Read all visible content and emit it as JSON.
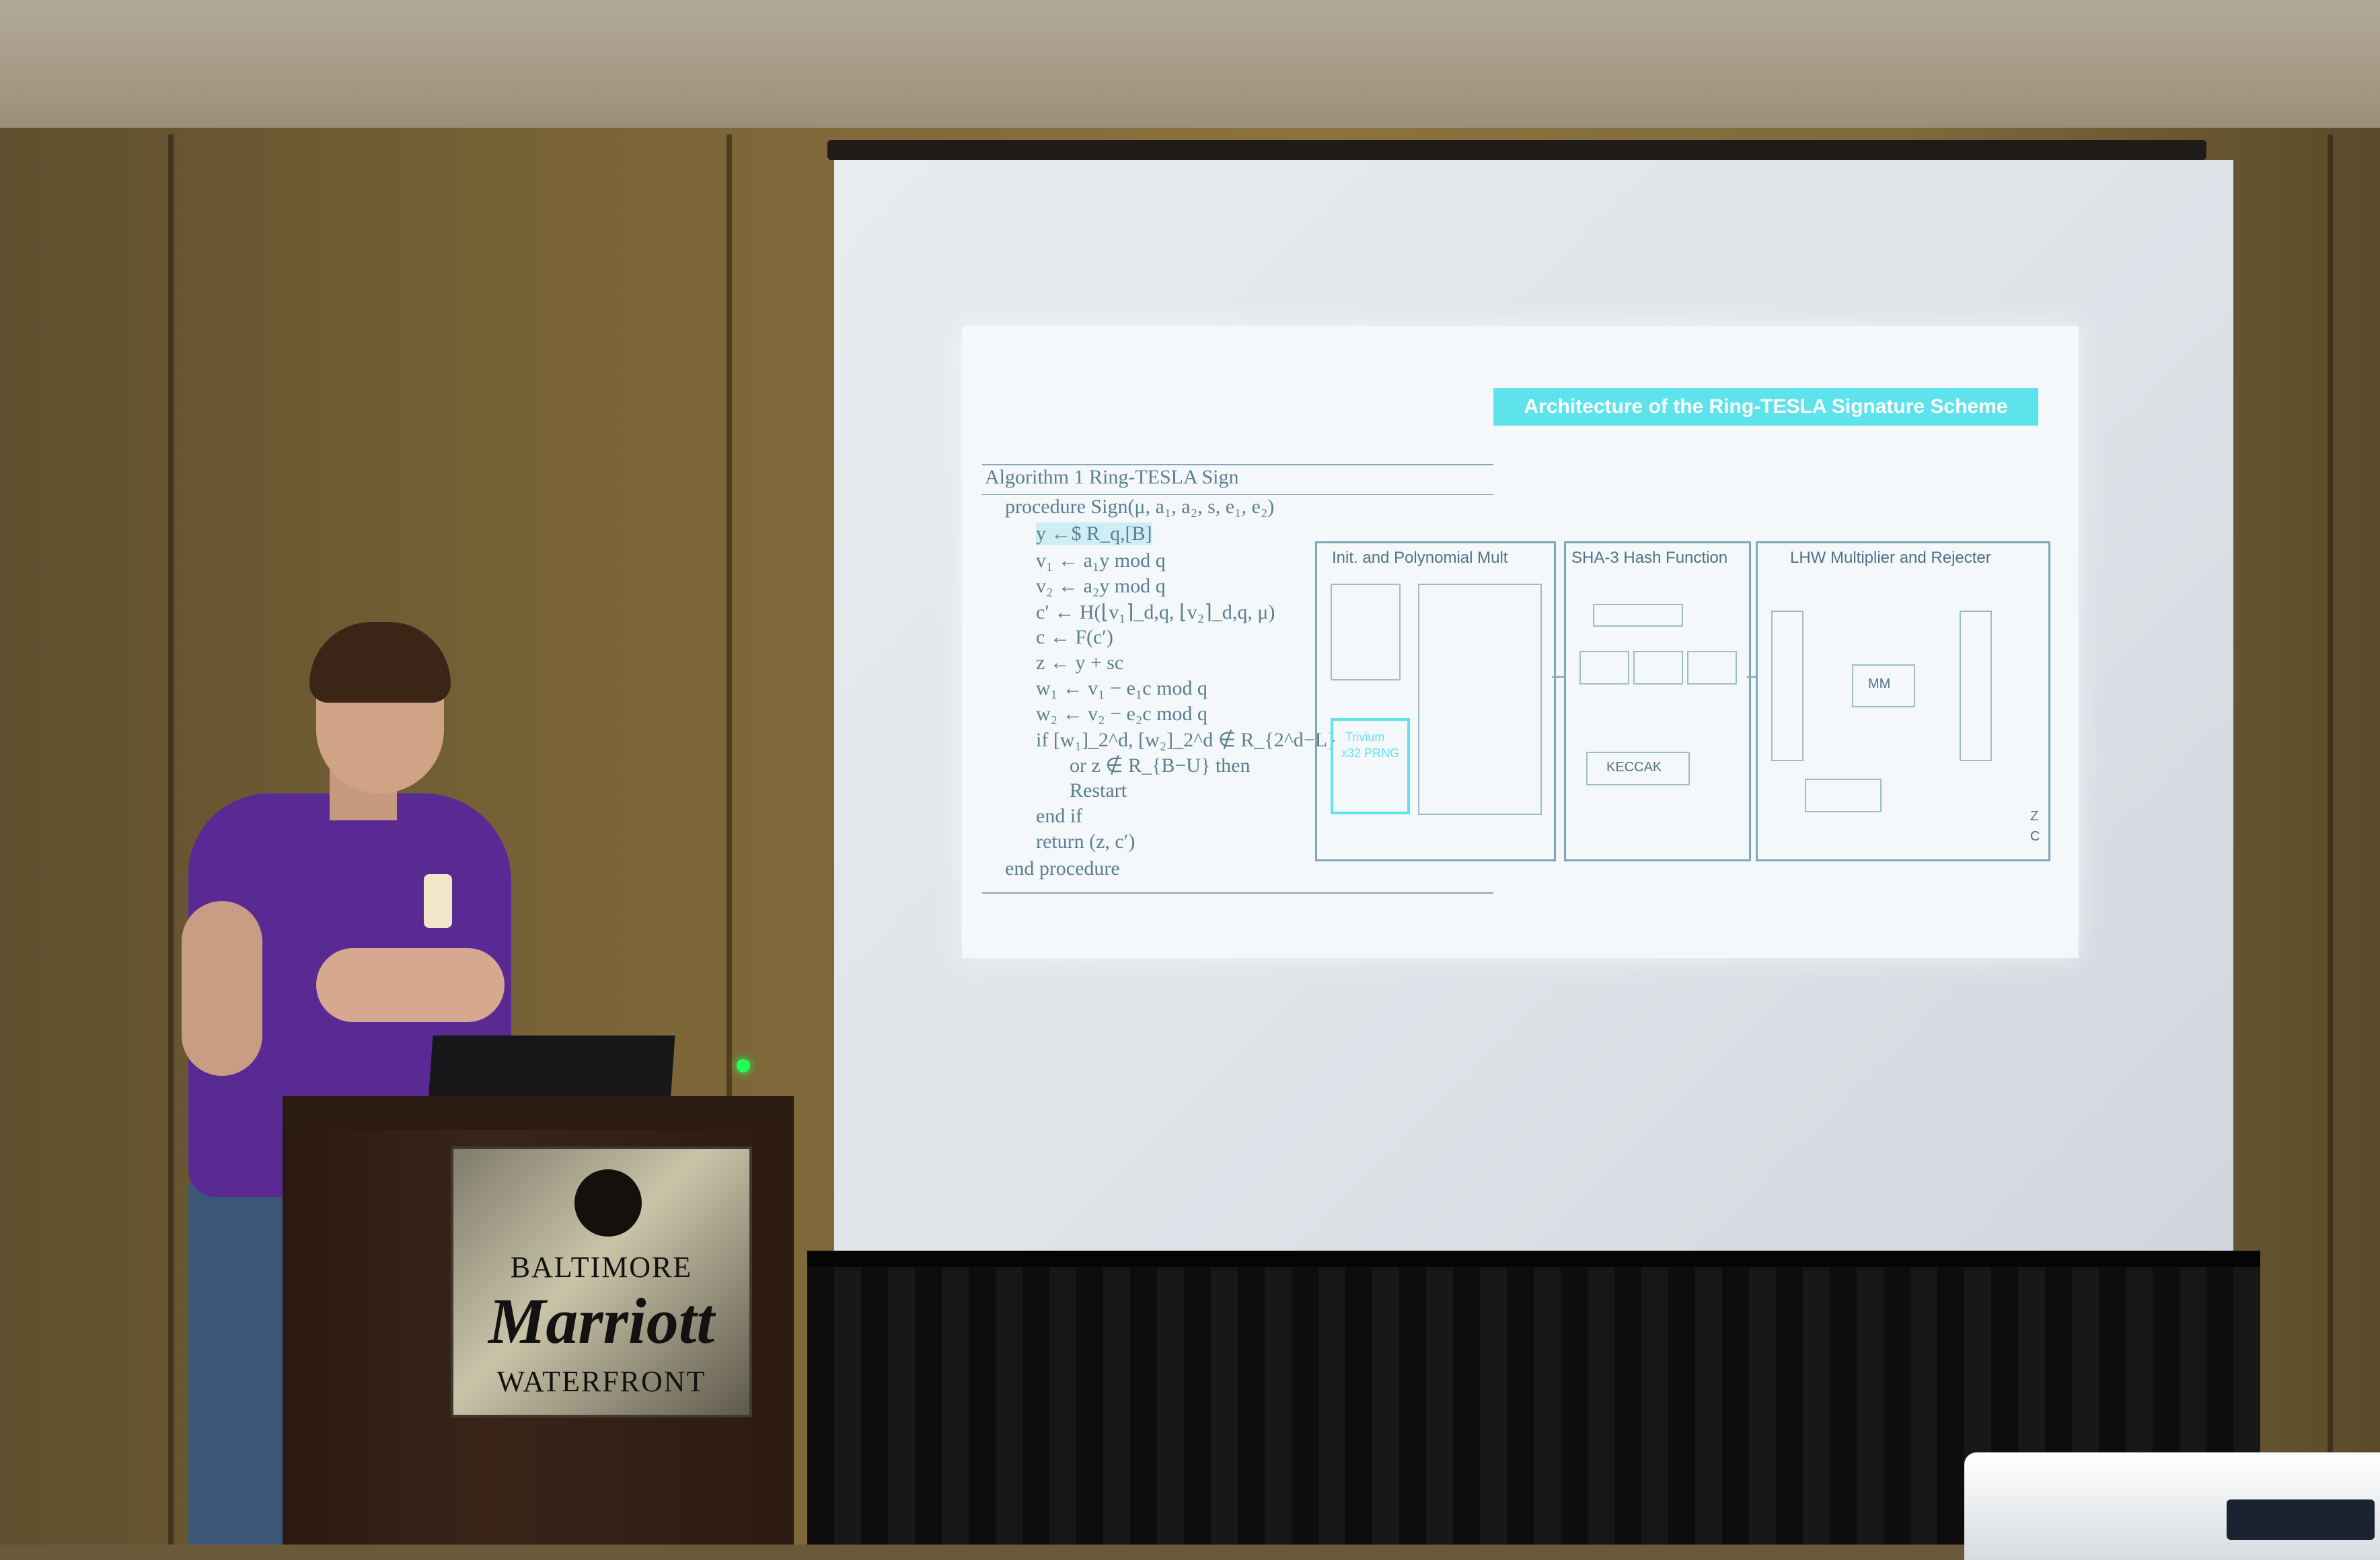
{
  "slide": {
    "title": "Architecture of the Ring-TESLA Signature Scheme",
    "algorithm_caption": "Algorithm 1 Ring-TESLA Sign",
    "algorithm_lines": [
      "procedure Sign(μ, a₁, a₂, s, e₁, e₂)",
      "y ←$ R_q,[B]",
      "v₁ ← a₁y mod q",
      "v₂ ← a₂y mod q",
      "c′ ← H(⌊v₁⌉_d,q, ⌊v₂⌉_d,q, μ)",
      "c ← F(c′)",
      "z ← y + sc",
      "w₁ ← v₁ − e₁c mod q",
      "w₂ ← v₂ − e₂c mod q",
      "if [w₁]_2^d, [w₂]_2^d ∉ R_{2^d−L}",
      "or z ∉ R_{B−U} then",
      "Restart",
      "end if",
      "return (z, c′)",
      "end procedure"
    ],
    "blocks": [
      {
        "label": "Init. and Polynomial Mult"
      },
      {
        "label": "SHA-3 Hash Function"
      },
      {
        "label": "LHW Multiplier and Rejecter"
      }
    ],
    "inner_labels": {
      "keccak": "KECCAK",
      "trivium": "Trivium",
      "prng": "x32 PRNG",
      "mm": "MM",
      "z": "Z",
      "c": "C"
    }
  },
  "podium_sign": {
    "line1": "BALTIMORE",
    "line2": "Marriott",
    "line3": "WATERFRONT"
  },
  "colors": {
    "slide_accent": "#5ee3ec",
    "shirt": "#5a2a94",
    "podium": "#2b1a12"
  }
}
